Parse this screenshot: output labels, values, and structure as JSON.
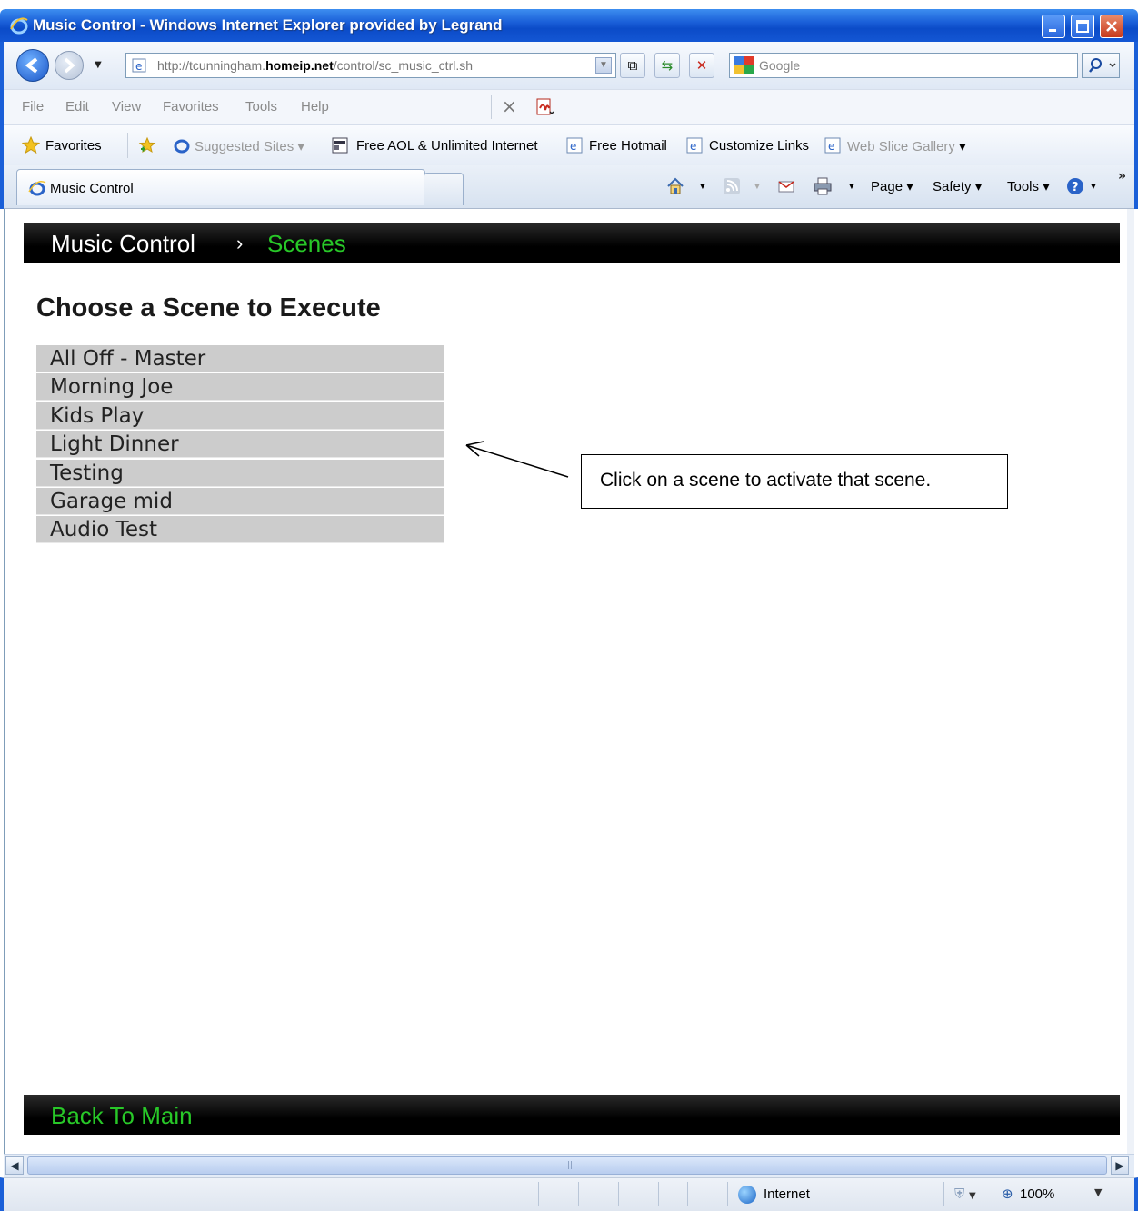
{
  "window": {
    "title": "Music Control - Windows Internet Explorer provided by Legrand"
  },
  "toolbar": {
    "url_prefix": "http://tcunningham.",
    "url_domain": "homeip.net",
    "url_path": "/control/sc_music_ctrl.sh",
    "search_placeholder": "Google"
  },
  "menu": [
    "File",
    "Edit",
    "View",
    "Favorites",
    "Tools",
    "Help"
  ],
  "favorites_bar": {
    "favorites": "Favorites",
    "suggested": "Suggested Sites",
    "links": [
      "Free AOL & Unlimited Internet",
      "Free Hotmail",
      "Customize Links"
    ],
    "web_slice": "Web Slice Gallery"
  },
  "tab": {
    "label": "Music Control"
  },
  "commands": {
    "page": "Page",
    "safety": "Safety",
    "tools": "Tools"
  },
  "page": {
    "breadcrumb_root": "Music Control",
    "breadcrumb_sep": "›",
    "breadcrumb_current": "Scenes",
    "heading": "Choose a Scene to Execute",
    "scenes": [
      "All Off - Master",
      "Morning Joe",
      "Kids Play",
      "Light Dinner",
      "Testing",
      "Garage mid",
      "Audio Test"
    ],
    "callout": "Click on a scene to activate that scene.",
    "back_link": "Back To Main",
    "accent_color": "#28c828"
  },
  "status": {
    "zone": "Internet",
    "zoom": "100%"
  }
}
